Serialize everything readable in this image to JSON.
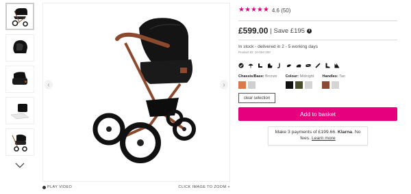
{
  "colors": {
    "accent": "#e6007e"
  },
  "gallery": {
    "thumbnails": [
      "stroller-thumb",
      "car-seat-thumb",
      "carry-cot-thumb",
      "changing-bag-thumb",
      "stroller-side-thumb"
    ],
    "play_video_label": "PLAY VIDEO",
    "zoom_label": "CLICK IMAGE TO ZOOM +"
  },
  "product": {
    "rating": 4.6,
    "rating_text": "4.6 (50)",
    "price": "£599.00",
    "save_text": "| Save £195",
    "stock": "In stock - delivered in 2 - 5 working days",
    "product_id": "Product ID: 10-004-200"
  },
  "feature_icons": [
    "check-icon",
    "umbrella-icon",
    "seat-icon",
    "car-seat-icon",
    "bag-icon",
    "foot-muff-icon",
    "cot-icon",
    "mattress-icon",
    "rain-cover-icon",
    "boot-icon",
    "adapters-icon"
  ],
  "options": {
    "chassis": {
      "label": "Chassis/Base:",
      "value": "Bronze",
      "swatches": [
        "#d97a4a",
        "#cfcfcf"
      ]
    },
    "colour": {
      "label": "Colour:",
      "value": "Midnight",
      "swatches": [
        "#111111",
        "#4a4e2a",
        "#d5d5d5"
      ]
    },
    "handles": {
      "label": "Handles:",
      "value": "Tan",
      "swatches": [
        "#8a4a34",
        "#d5d5d5"
      ]
    }
  },
  "buttons": {
    "clear_selection": "clear selection",
    "add_to_basket": "Add to basket"
  },
  "klarna": {
    "line1": "Make 3 payments of £199.66.",
    "brand": "Klarna",
    "line1_tail": ". No",
    "line2": "fees.",
    "learn_more": "Learn more"
  }
}
